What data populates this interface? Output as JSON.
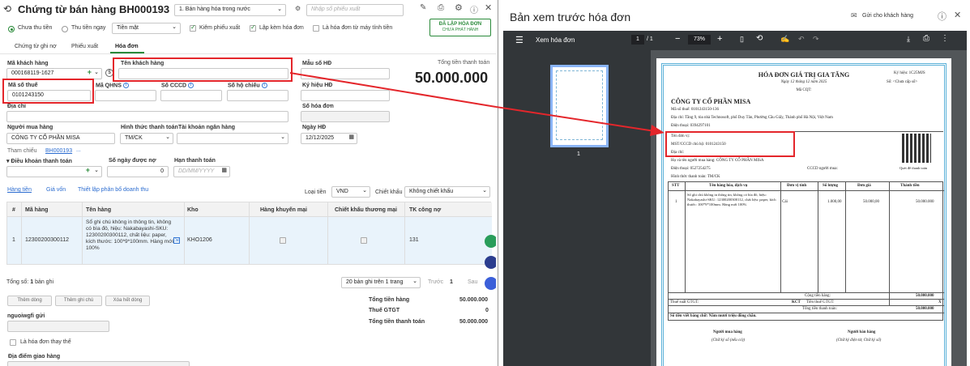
{
  "app": {
    "title": "Chứng từ bán hàng BH000193",
    "sale_type": "1. Bán hàng hóa trong nước",
    "search_placeholder": "Nhập số phiếu xuất"
  },
  "payment": {
    "options": [
      "Chưa thu tiền",
      "Thu tiền ngay"
    ],
    "method": "Tiền mặt"
  },
  "checks": [
    "Kiêm phiếu xuất",
    "Lập kèm hóa đơn",
    "Là hóa đơn từ máy tính tiền"
  ],
  "issue_button": {
    "line1": "ĐÃ LẬP HÓA ĐƠN",
    "line2": "CHƯA PHÁT HÀNH"
  },
  "tabs": [
    "Chứng từ ghi nợ",
    "Phiếu xuất",
    "Hóa đơn"
  ],
  "form": {
    "customer_code_label": "Mã khách hàng",
    "customer_code": "000168119-1627",
    "customer_name_label": "Tên khách hàng",
    "invoice_symbol_label": "Mẫu số HĐ",
    "tax_code_label": "Mã số thuế",
    "tax_code": "0101243150",
    "qhns_label": "Mã QHNS",
    "cccd_label": "Số CCCD",
    "passport_label": "Số hộ chiếu",
    "symbol_label": "Ký hiệu HĐ",
    "address_label": "Địa chỉ",
    "invoice_no_label": "Số hóa đơn",
    "buyer_label": "Người mua hàng",
    "buyer": "CÔNG TY CỔ PHẦN MISA",
    "pay_form_label": "Hình thức thanh toán",
    "pay_form": "TM/CK",
    "bank_label": "Tài khoản ngân hàng",
    "date_label": "Ngày HĐ",
    "date": "12/12/2025",
    "ref_label": "Tham chiếu",
    "ref": "BH000193",
    "ref_more": "...",
    "terms_label": "Điều khoản thanh toán",
    "days_label": "Số ngày được nợ",
    "days": "0",
    "due_label": "Hạn thanh toán",
    "due_placeholder": "DD/MM/YYYY",
    "total_label": "Tổng tiền thanh toán",
    "total": "50.000.000"
  },
  "subtabs": [
    "Hàng tiền",
    "Giá vốn",
    "Thiết lập phân bổ doanh thu"
  ],
  "currency_label": "Loại tiền",
  "currency": "VND",
  "discount_label": "Chiết khấu",
  "discount": "Không chiết khấu",
  "table": {
    "headers": [
      "#",
      "Mã hàng",
      "Tên hàng",
      "Kho",
      "Hàng khuyến mại",
      "Chiết khấu thương mại",
      "TK công nợ"
    ],
    "row": {
      "no": "1",
      "code": "12300200300112",
      "name": "Sổ ghi chú không in thông tin, không có bìa đô, hiệu: Nakabayashi-SKU: 12300200300112, chất liệu: paper, kích thước: 100*9*100mm. Hàng mới 100%",
      "warehouse": "KHO1206",
      "account": "131"
    }
  },
  "footer": {
    "count_label": "Tổng số:",
    "count": "1",
    "count_unit": "bản ghi",
    "page_size": "20 bản ghi trên 1 trang",
    "prev": "Trước",
    "page": "1",
    "next": "Sau",
    "buttons": [
      "Thêm dòng",
      "Thêm ghi chú",
      "Xóa hết dòng"
    ],
    "note_label": "nguoiwgfi gửi",
    "replace_label": "Là hóa đơn thay thế",
    "delivery_label": "Địa điểm giao hàng",
    "sums": [
      {
        "label": "Tổng tiền hàng",
        "value": "50.000.000"
      },
      {
        "label": "Thuế GTGT",
        "value": "0"
      },
      {
        "label": "Tổng tiền thanh toán",
        "value": "50.000.000"
      }
    ]
  },
  "preview": {
    "title": "Bản xem trước hóa đơn",
    "send_label": "Gửi cho khách hàng",
    "toolbar_title": "Xem hóa đơn",
    "page": "1",
    "pages": "/ 1",
    "zoom": "73%",
    "thumb_no": "1"
  },
  "invoice": {
    "title": "HÓA ĐƠN GIÁ TRỊ GIA TĂNG",
    "date_line": "Ngày 12 tháng 12 năm 2025",
    "cqt": "Mã CQT:",
    "symbol": "Ký hiệu: 1C25MJS",
    "number": "Số: <Chưa cấp số>",
    "seller": "CÔNG TY CỔ PHẦN MISA",
    "seller_tax": "Mã số thuế: 0101243150-136",
    "seller_address": "Địa chỉ: Tầng 9, tòa nhà Technosoft, phố Duy Tân, Phường Cầu Giấy, Thành phố Hà Nội, Việt Nam",
    "seller_phone": "Điện thoại: 0394297101",
    "unit_label": "Tên đơn vị:",
    "buyer_mst": "MST/CCCD chủ hộ: 0101243150",
    "buyer_addr": "Địa chỉ:",
    "qr_caption": "Quét để thanh toán",
    "buyer_person": "Họ và tên người mua hàng: CÔNG TY CỔ PHẦN MISA",
    "phone": "Điện thoại: 0527254275",
    "cccd": "CCCD người mua:",
    "pay": "Hình thức thanh toán: TM/CK",
    "headers": [
      "STT",
      "Tên hàng hóa, dịch vụ",
      "Đơn vị tính",
      "Số lượng",
      "Đơn giá",
      "Thành tiền"
    ],
    "item": {
      "no": "1",
      "name": "Sổ ghi chú không in thông tin, không có bìa đô, hiệu: Nakabayashi-SKU: 12300200300112, chất liệu: paper, kích thước: 100*9*100mm. Hàng mới 100%",
      "unit": "Cái",
      "qty": "1.000,00",
      "price": "50.000,00",
      "amount": "50.000.000"
    },
    "sum_goods_label": "Cộng tiền hàng:",
    "sum_goods": "50.000.000",
    "vat_rate_label": "Thuế suất GTGT:",
    "vat_rate": "KCT",
    "vat_label": "Tiền thuế GTGT:",
    "vat": "X",
    "total_label": "Tổng tiền thanh toán:",
    "total": "50.000.000",
    "words": "Số tiền viết bằng chữ: Năm mươi triệu đồng chẵn.",
    "buyer_sign": "Người mua hàng",
    "buyer_sign_note": "(Chữ ký số (nếu có))",
    "seller_sign": "Người bán hàng",
    "seller_sign_note": "(Chữ ký điện tử, Chữ ký số)"
  },
  "colors": {
    "accent": "#2a8a3a",
    "link": "#2b6cd0",
    "annotation": "#e4262b",
    "viewer_bg": "#525659",
    "toolbar": "#323639"
  }
}
